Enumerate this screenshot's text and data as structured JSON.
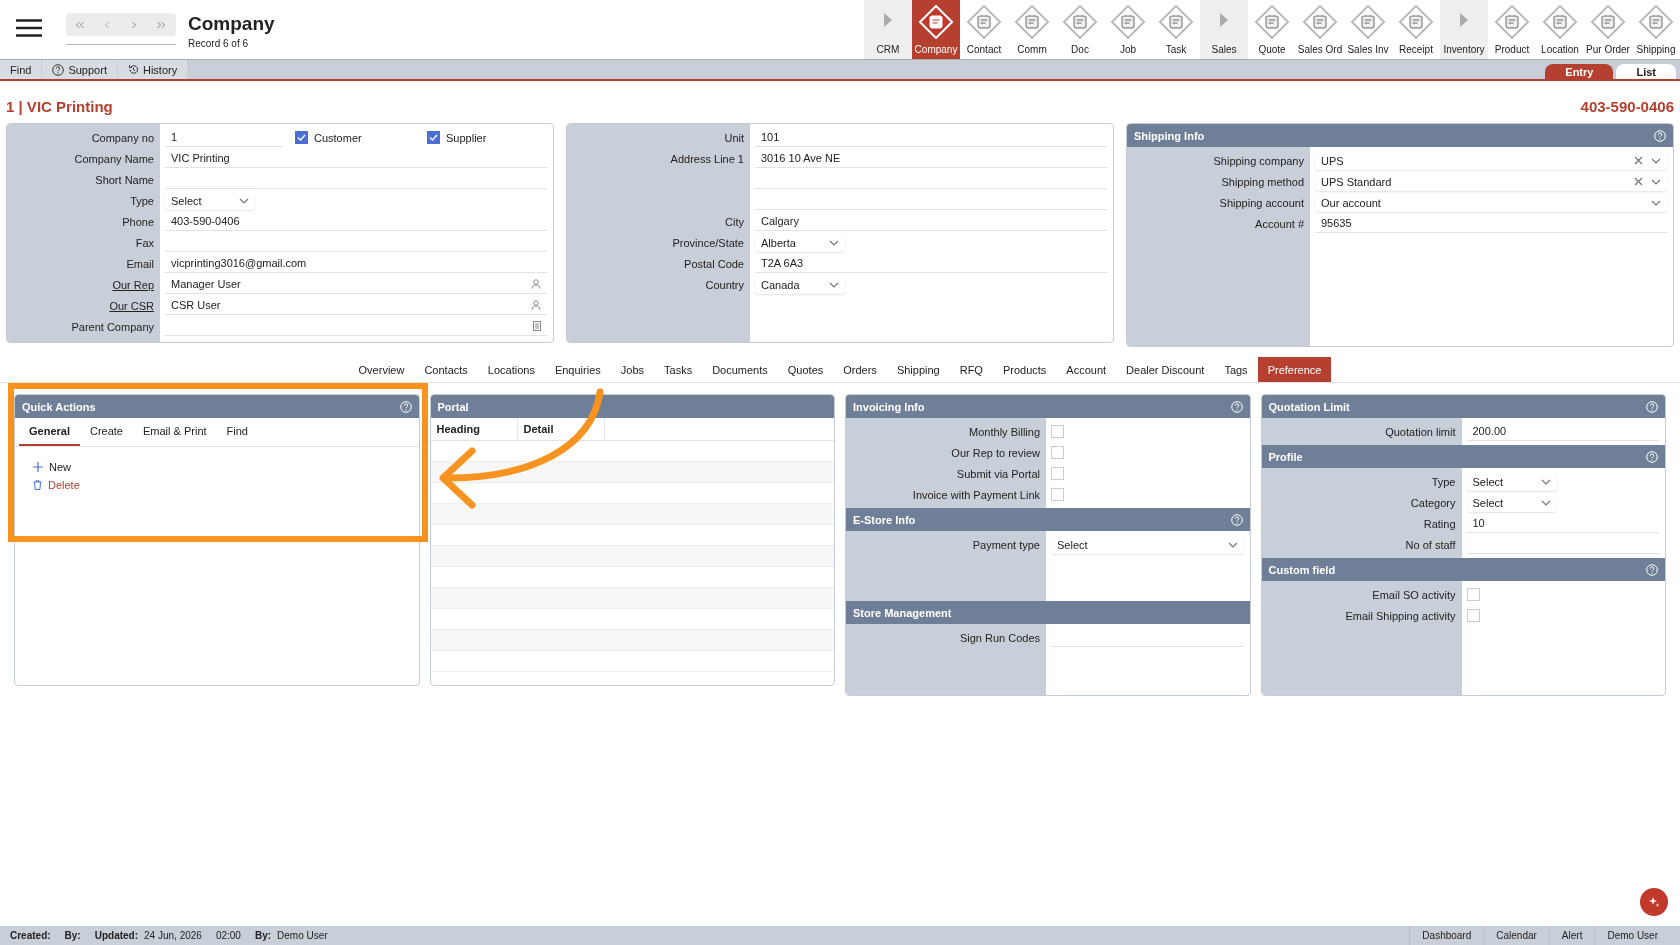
{
  "header": {
    "title": "Company",
    "record": "Record 6 of 6"
  },
  "modules": [
    {
      "label": "CRM",
      "kind": "group",
      "selected": false
    },
    {
      "label": "Company",
      "kind": "module",
      "selected": true
    },
    {
      "label": "Contact",
      "kind": "module",
      "selected": false
    },
    {
      "label": "Comm",
      "kind": "module",
      "selected": false
    },
    {
      "label": "Doc",
      "kind": "module",
      "selected": false
    },
    {
      "label": "Job",
      "kind": "module",
      "selected": false
    },
    {
      "label": "Task",
      "kind": "module",
      "selected": false
    },
    {
      "label": "Sales",
      "kind": "group",
      "selected": false
    },
    {
      "label": "Quote",
      "kind": "module",
      "selected": false
    },
    {
      "label": "Sales Ord",
      "kind": "module",
      "selected": false
    },
    {
      "label": "Sales Inv",
      "kind": "module",
      "selected": false
    },
    {
      "label": "Receipt",
      "kind": "module",
      "selected": false
    },
    {
      "label": "Inventory",
      "kind": "group",
      "selected": false
    },
    {
      "label": "Product",
      "kind": "module",
      "selected": false
    },
    {
      "label": "Location",
      "kind": "module",
      "selected": false
    },
    {
      "label": "Pur Order",
      "kind": "module",
      "selected": false
    },
    {
      "label": "Shipping",
      "kind": "module",
      "selected": false
    }
  ],
  "toolbar": [
    {
      "label": "Find",
      "kind": "plain"
    },
    {
      "label": "Support",
      "kind": "help"
    },
    {
      "label": "History",
      "kind": "history"
    }
  ],
  "view_tabs": [
    {
      "label": "Entry",
      "selected": true
    },
    {
      "label": "List",
      "selected": false
    }
  ],
  "record_title": "1 | VIC Printing",
  "record_phone": "403-590-0406",
  "company_form": {
    "rows": [
      {
        "label": "Company no",
        "value": "1",
        "kind": "text",
        "link": false,
        "checks": [
          {
            "label": "Customer",
            "checked": true
          },
          {
            "label": "Supplier",
            "checked": true
          }
        ]
      },
      {
        "label": "Company Name",
        "value": "VIC Printing",
        "kind": "text",
        "link": false
      },
      {
        "label": "Short Name",
        "kind": "text",
        "link": false
      },
      {
        "label": "Type",
        "value": "Select",
        "kind": "select",
        "link": false
      },
      {
        "label": "Phone",
        "value": "403-590-0406",
        "kind": "text",
        "link": false
      },
      {
        "label": "Fax",
        "kind": "text",
        "link": false
      },
      {
        "label": "Email",
        "value": "vicprinting3016@gmail.com",
        "kind": "text",
        "link": false
      },
      {
        "label": "Our Rep",
        "value": "Manager User",
        "kind": "person",
        "link": true
      },
      {
        "label": "Our CSR",
        "value": "CSR User",
        "kind": "person",
        "link": true
      },
      {
        "label": "Parent Company",
        "kind": "document",
        "link": false
      }
    ]
  },
  "address_form": {
    "rows": [
      {
        "label": "Unit",
        "value": "101",
        "kind": "text"
      },
      {
        "label": "Address Line 1",
        "value": "3016 10 Ave NE",
        "kind": "text"
      },
      {
        "kind": "text"
      },
      {
        "kind": "text"
      },
      {
        "label": "City",
        "value": "Calgary",
        "kind": "text"
      },
      {
        "label": "Province/State",
        "value": "Alberta",
        "kind": "select"
      },
      {
        "label": "Postal Code",
        "value": "T2A 6A3",
        "kind": "text"
      },
      {
        "label": "Country",
        "value": "Canada",
        "kind": "select"
      }
    ]
  },
  "shipping_info": {
    "title": "Shipping Info",
    "help": true,
    "rows": [
      {
        "label": "Shipping company",
        "value": "UPS",
        "kind": "dropdown",
        "clearable": true
      },
      {
        "label": "Shipping method",
        "value": "UPS Standard",
        "kind": "dropdown",
        "clearable": true
      },
      {
        "label": "Shipping account",
        "value": "Our account",
        "kind": "dropdown",
        "clearable": false
      },
      {
        "label": "Account #",
        "value": "95635",
        "kind": "text"
      }
    ]
  },
  "detail_tabs": [
    {
      "label": "Overview",
      "selected": false
    },
    {
      "label": "Contacts",
      "selected": false
    },
    {
      "label": "Locations",
      "selected": false
    },
    {
      "label": "Enquiries",
      "selected": false
    },
    {
      "label": "Jobs",
      "selected": false
    },
    {
      "label": "Tasks",
      "selected": false
    },
    {
      "label": "Documents",
      "selected": false
    },
    {
      "label": "Quotes",
      "selected": false
    },
    {
      "label": "Orders",
      "selected": false
    },
    {
      "label": "Shipping",
      "selected": false
    },
    {
      "label": "RFQ",
      "selected": false
    },
    {
      "label": "Products",
      "selected": false
    },
    {
      "label": "Account",
      "selected": false
    },
    {
      "label": "Dealer Discount",
      "selected": false
    },
    {
      "label": "Tags",
      "selected": false
    },
    {
      "label": "Preference",
      "selected": true
    }
  ],
  "quick_actions": {
    "title": "Quick Actions",
    "help": true,
    "tabs": [
      {
        "label": "General",
        "selected": true
      },
      {
        "label": "Create",
        "selected": false
      },
      {
        "label": "Email & Print",
        "selected": false
      },
      {
        "label": "Find",
        "selected": false
      }
    ],
    "actions": [
      {
        "label": "New",
        "kind": "add"
      },
      {
        "label": "Delete",
        "kind": "delete"
      }
    ]
  },
  "portal": {
    "title": "Portal",
    "columns": [
      "Heading",
      "Detail"
    ]
  },
  "preference_columns": [
    {
      "sections": [
        {
          "title": "Invoicing Info",
          "help": true,
          "rows": [
            {
              "label": "Monthly Billing",
              "kind": "checkbox",
              "checked": false
            },
            {
              "label": "Our Rep to review",
              "kind": "checkbox",
              "checked": false
            },
            {
              "label": "Submit via Portal",
              "kind": "checkbox",
              "checked": false
            },
            {
              "label": "Invoice with Payment Link",
              "kind": "checkbox",
              "checked": false
            }
          ]
        },
        {
          "title": "E-Store Info",
          "help": true,
          "rows": [
            {
              "label": "Payment type",
              "value": "Select",
              "kind": "dropdown"
            }
          ]
        },
        {
          "title": "Store Management",
          "help": false,
          "rows": [
            {
              "label": "Sign Run Codes",
              "kind": "text"
            }
          ]
        }
      ]
    },
    {
      "sections": [
        {
          "title": "Quotation Limit",
          "help": true,
          "rows": [
            {
              "label": "Quotation limit",
              "value": "200.00",
              "kind": "text"
            }
          ]
        },
        {
          "title": "Profile",
          "help": true,
          "rows": [
            {
              "label": "Type",
              "value": "Select",
              "kind": "select"
            },
            {
              "label": "Category",
              "value": "Select",
              "kind": "select"
            },
            {
              "label": "Rating",
              "value": "10",
              "kind": "text"
            },
            {
              "label": "No of staff",
              "kind": "text"
            }
          ]
        },
        {
          "title": "Custom field",
          "help": true,
          "rows": [
            {
              "label": "Email SO activity",
              "kind": "checkbox",
              "checked": false
            },
            {
              "label": "Email Shipping activity",
              "kind": "checkbox",
              "checked": false
            }
          ]
        }
      ]
    }
  ],
  "status_bar": {
    "left": [
      {
        "label": "Created:"
      },
      {
        "label": "By:"
      },
      {
        "label": "Updated:",
        "value": "24 Jun, 2026"
      },
      {
        "value": "02:00"
      },
      {
        "label": "By:",
        "value": "Demo User"
      }
    ],
    "right": [
      "Dashboard",
      "Calendar",
      "Alert",
      "Demo User"
    ]
  }
}
